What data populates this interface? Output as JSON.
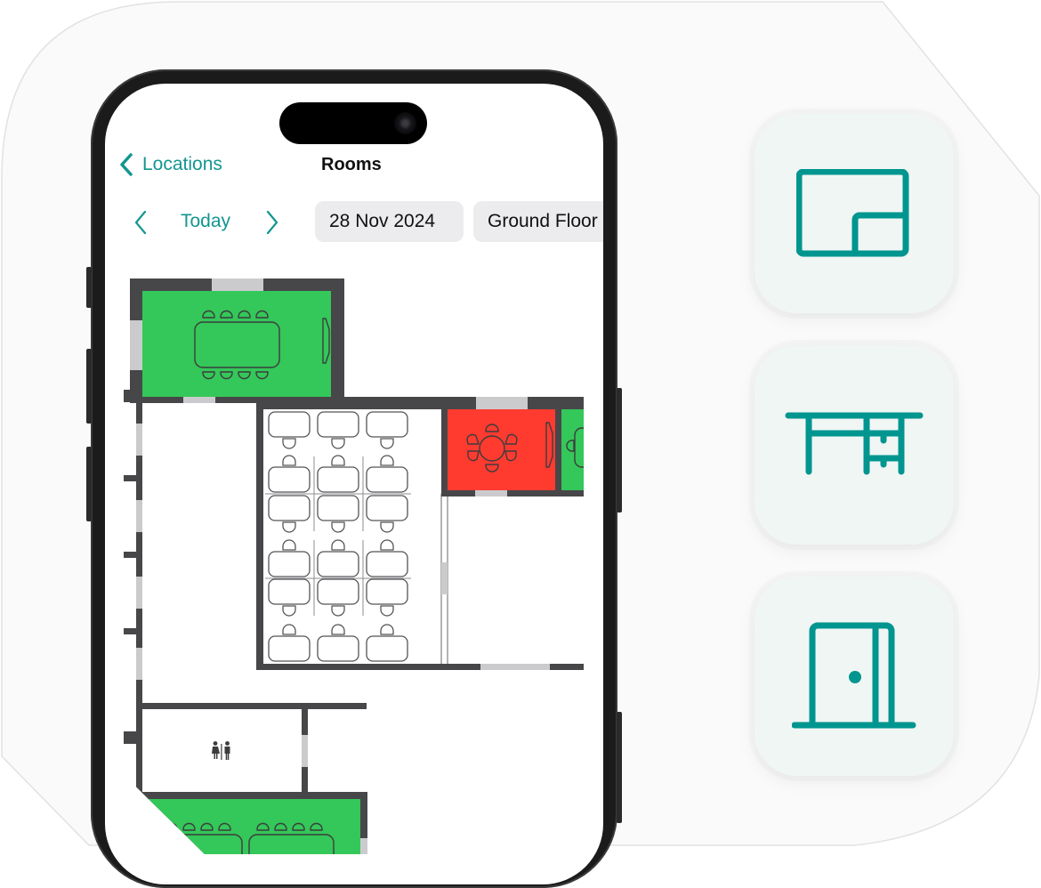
{
  "colors": {
    "accent": "#139690",
    "icon_teal": "#00958F",
    "room_available": "#34C759",
    "room_booked": "#FF3B30",
    "wall": "#474749",
    "window": "#CBCBCE",
    "pill_bg": "#ECECEE",
    "tile_bg": "#F0F6F4"
  },
  "nav": {
    "back_label": "Locations",
    "back_icon": "chevron-left",
    "title": "Rooms"
  },
  "date_bar": {
    "prev_icon": "chevron-left",
    "today_label": "Today",
    "next_icon": "chevron-right",
    "date_value": "28 Nov 2024",
    "floor_value": "Ground Floor"
  },
  "floorplan": {
    "rooms": [
      {
        "name": "Meeting room (8 seats)",
        "status": "available",
        "seats": 8
      },
      {
        "name": "Meeting room (6 seats, round)",
        "status": "booked",
        "seats": 6
      },
      {
        "name": "Meeting room (partial)",
        "status": "available"
      },
      {
        "name": "Open desk area",
        "status": "unbookable",
        "desks": 18
      },
      {
        "name": "Restroom",
        "status": "facility",
        "icon": "restroom-icon"
      },
      {
        "name": "Meeting room (bottom)",
        "status": "available",
        "seats": 8
      }
    ]
  },
  "feature_tiles": [
    {
      "name": "floor-plan",
      "icon": "floor-plan-icon"
    },
    {
      "name": "desk",
      "icon": "desk-icon"
    },
    {
      "name": "room",
      "icon": "door-icon"
    }
  ]
}
